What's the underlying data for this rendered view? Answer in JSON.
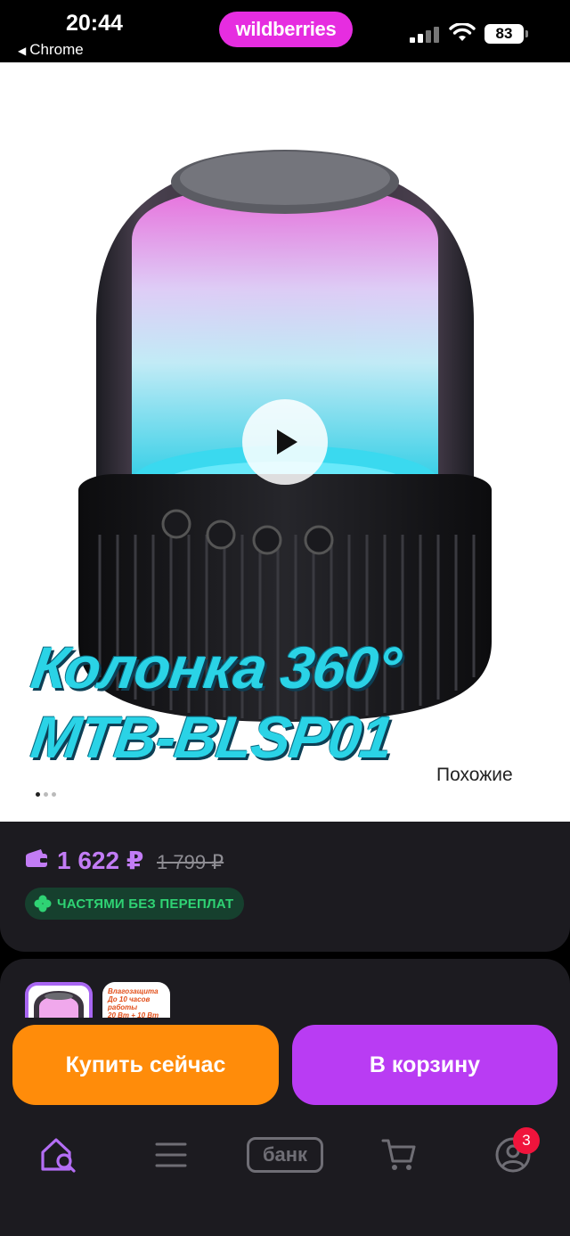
{
  "status_bar": {
    "time": "20:44",
    "back_app": "Chrome",
    "brand": "wildberries",
    "battery": "83"
  },
  "hero": {
    "title_lines": [
      "Колонка 360°",
      "MTB-BLSP01"
    ],
    "similar_label": "Похожие",
    "gallery_total_dots": 3,
    "gallery_active_index": 0
  },
  "price": {
    "current": "1 622 ₽",
    "old": "1 799 ₽",
    "installments": "ЧАСТЯМИ БЕЗ ПЕРЕПЛАТ"
  },
  "variants": {
    "thumb2_text": "Влагозащита\nДо 10 часов работы\n20 Вт + 10 Вт"
  },
  "actions": {
    "buy_now": "Купить сейчас",
    "add_to_cart": "В корзину"
  },
  "bottom_nav": {
    "bank_label": "банк",
    "profile_badge": "3"
  },
  "colors": {
    "brand": "#e62de0",
    "price": "#c27cf5",
    "buy_button": "#ff8c0a",
    "cart_button": "#b93cf3",
    "installments_text": "#2fd374"
  }
}
